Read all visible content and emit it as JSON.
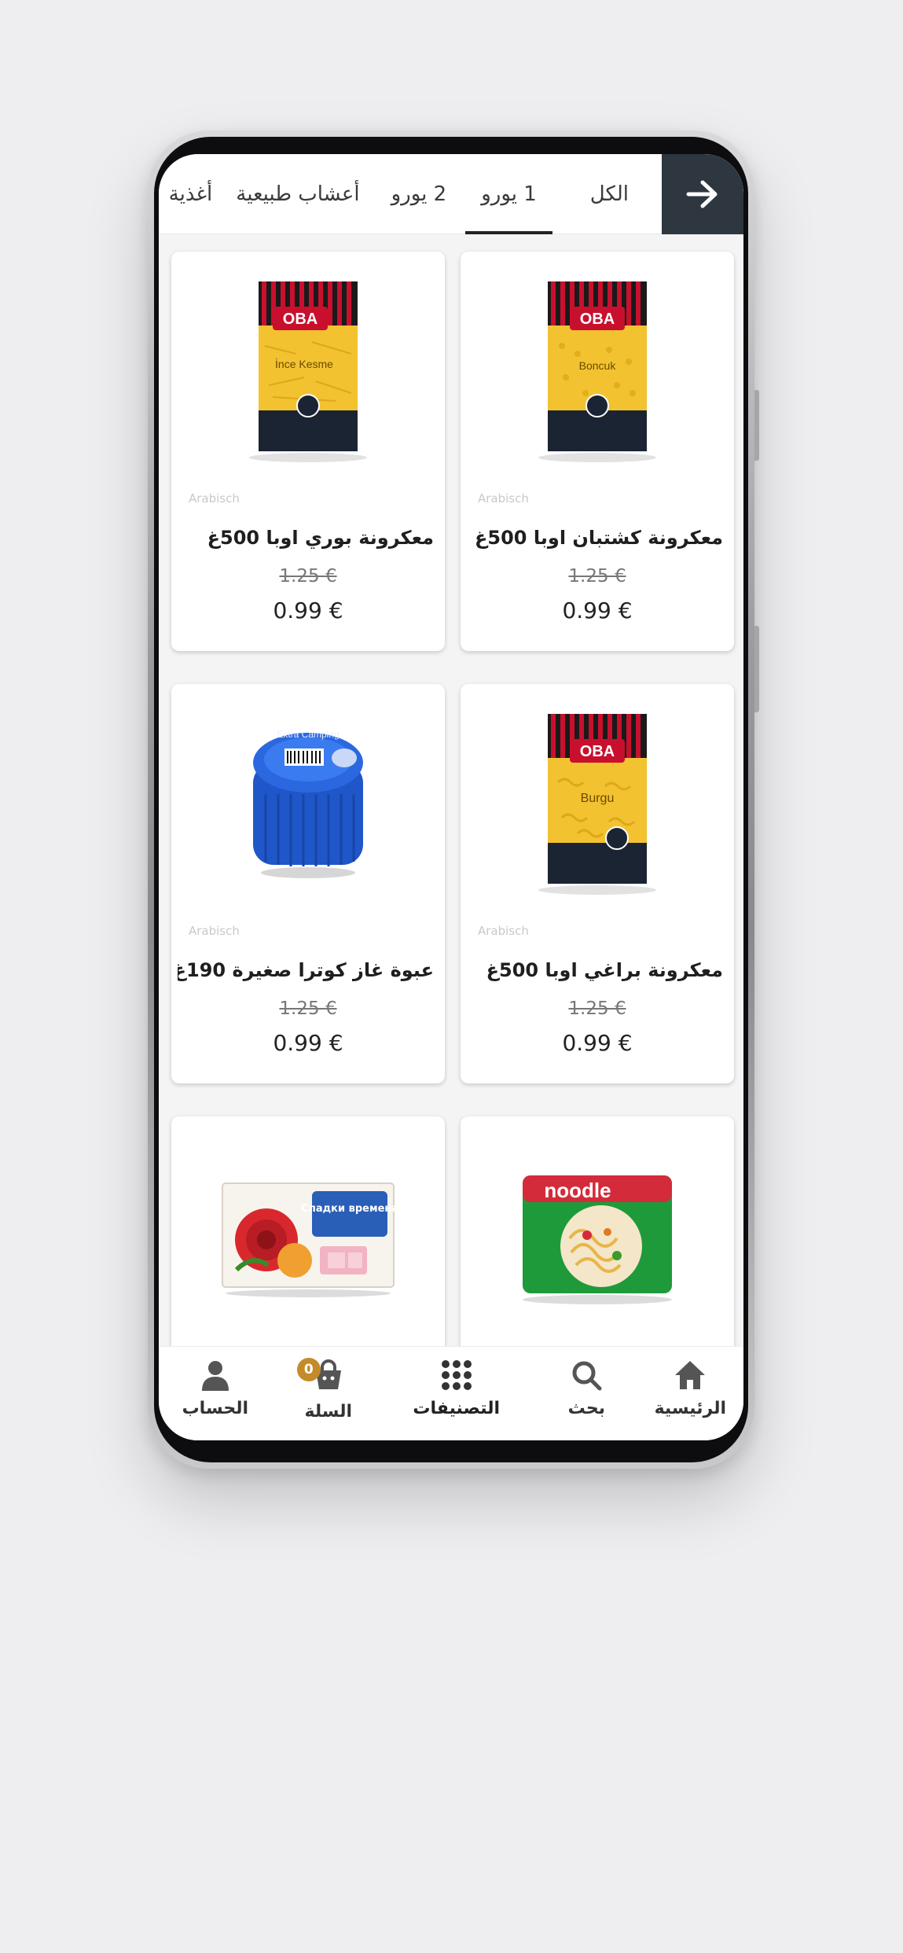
{
  "tabs": [
    {
      "label": "الكل",
      "active": false
    },
    {
      "label": "1 يورو",
      "active": true
    },
    {
      "label": "2 يورو",
      "active": false
    },
    {
      "label": "أعشاب طبيعية",
      "active": false
    },
    {
      "label": "أغذية",
      "active": false
    }
  ],
  "products": [
    {
      "name": "معكرونة كشتبان اوبا 500غ",
      "old_price": "1.25 €",
      "price": "0.99 €",
      "watermark": "Arabisch",
      "package_text": "Boncuk",
      "brand": "OBA"
    },
    {
      "name": "معكرونة بوري اوبا 500غ",
      "old_price": "1.25 €",
      "price": "0.99 €",
      "watermark": "Arabisch",
      "package_text": "İnce Kesme",
      "brand": "OBA"
    },
    {
      "name": "معكرونة براغي اوبا 500غ",
      "old_price": "1.25 €",
      "price": "0.99 €",
      "watermark": "Arabisch",
      "package_text": "Burgu",
      "brand": "OBA"
    },
    {
      "name": "عبوة غاز كوترا صغيرة 190غ",
      "old_price": "1.25 €",
      "price": "0.99 €",
      "watermark": "Arabisch",
      "package_text": "Extra Camping",
      "brand": ""
    },
    {
      "name": "",
      "old_price": "",
      "price": "",
      "watermark": "",
      "package_text": "noodle",
      "brand": ""
    },
    {
      "name": "",
      "old_price": "",
      "price": "",
      "watermark": "",
      "package_text": "Сладки времена",
      "brand": ""
    }
  ],
  "nav": {
    "home": "الرئيسية",
    "search": "بحث",
    "categories": "التصنيفات",
    "cart": "السلة",
    "cart_count": "0",
    "account": "الحساب"
  },
  "colors": {
    "header_dark": "#2e3640",
    "badge": "#c58b2a",
    "oba_red": "#c8102e",
    "oba_stripe": "#1a1a1a",
    "pasta_yellow": "#f2c230"
  },
  "icons": [
    "arrow-right-icon",
    "home-icon",
    "search-icon",
    "grid-icon",
    "shopping-bag-icon",
    "user-icon"
  ]
}
